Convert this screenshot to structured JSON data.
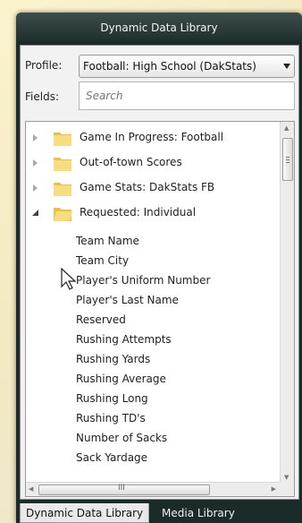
{
  "window": {
    "title": "Dynamic Data Library"
  },
  "profile": {
    "label": "Profile:",
    "value": "Football: High School (DakStats)"
  },
  "fields": {
    "label": "Fields:",
    "placeholder": "Search"
  },
  "tree": {
    "folders": [
      {
        "label": "Game In Progress: Football",
        "expanded": false
      },
      {
        "label": "Out-of-town Scores",
        "expanded": false
      },
      {
        "label": "Game Stats: DakStats FB",
        "expanded": false
      },
      {
        "label": "Requested: Individual",
        "expanded": true
      }
    ],
    "fields": [
      "Team Name",
      "Team City",
      "Player's Uniform Number",
      "Player's Last Name",
      "Reserved",
      "Rushing Attempts",
      "Rushing Yards",
      "Rushing Average",
      "Rushing Long",
      "Rushing TD's",
      "Number of Sacks",
      "Sack Yardage"
    ]
  },
  "scrollbar": {
    "hthumb_glyph": "III"
  },
  "tabs": [
    {
      "label": "Dynamic Data Library",
      "active": true
    },
    {
      "label": "Media Library",
      "active": false
    }
  ],
  "icons": {
    "folder": "folder-icon",
    "expander": "expander-arrow-icon",
    "cursor": "mouse-pointer-icon"
  },
  "colors": {
    "folder": "#f5d36e",
    "titlebar": "#2a3a39",
    "window": "#1b2b2a"
  }
}
